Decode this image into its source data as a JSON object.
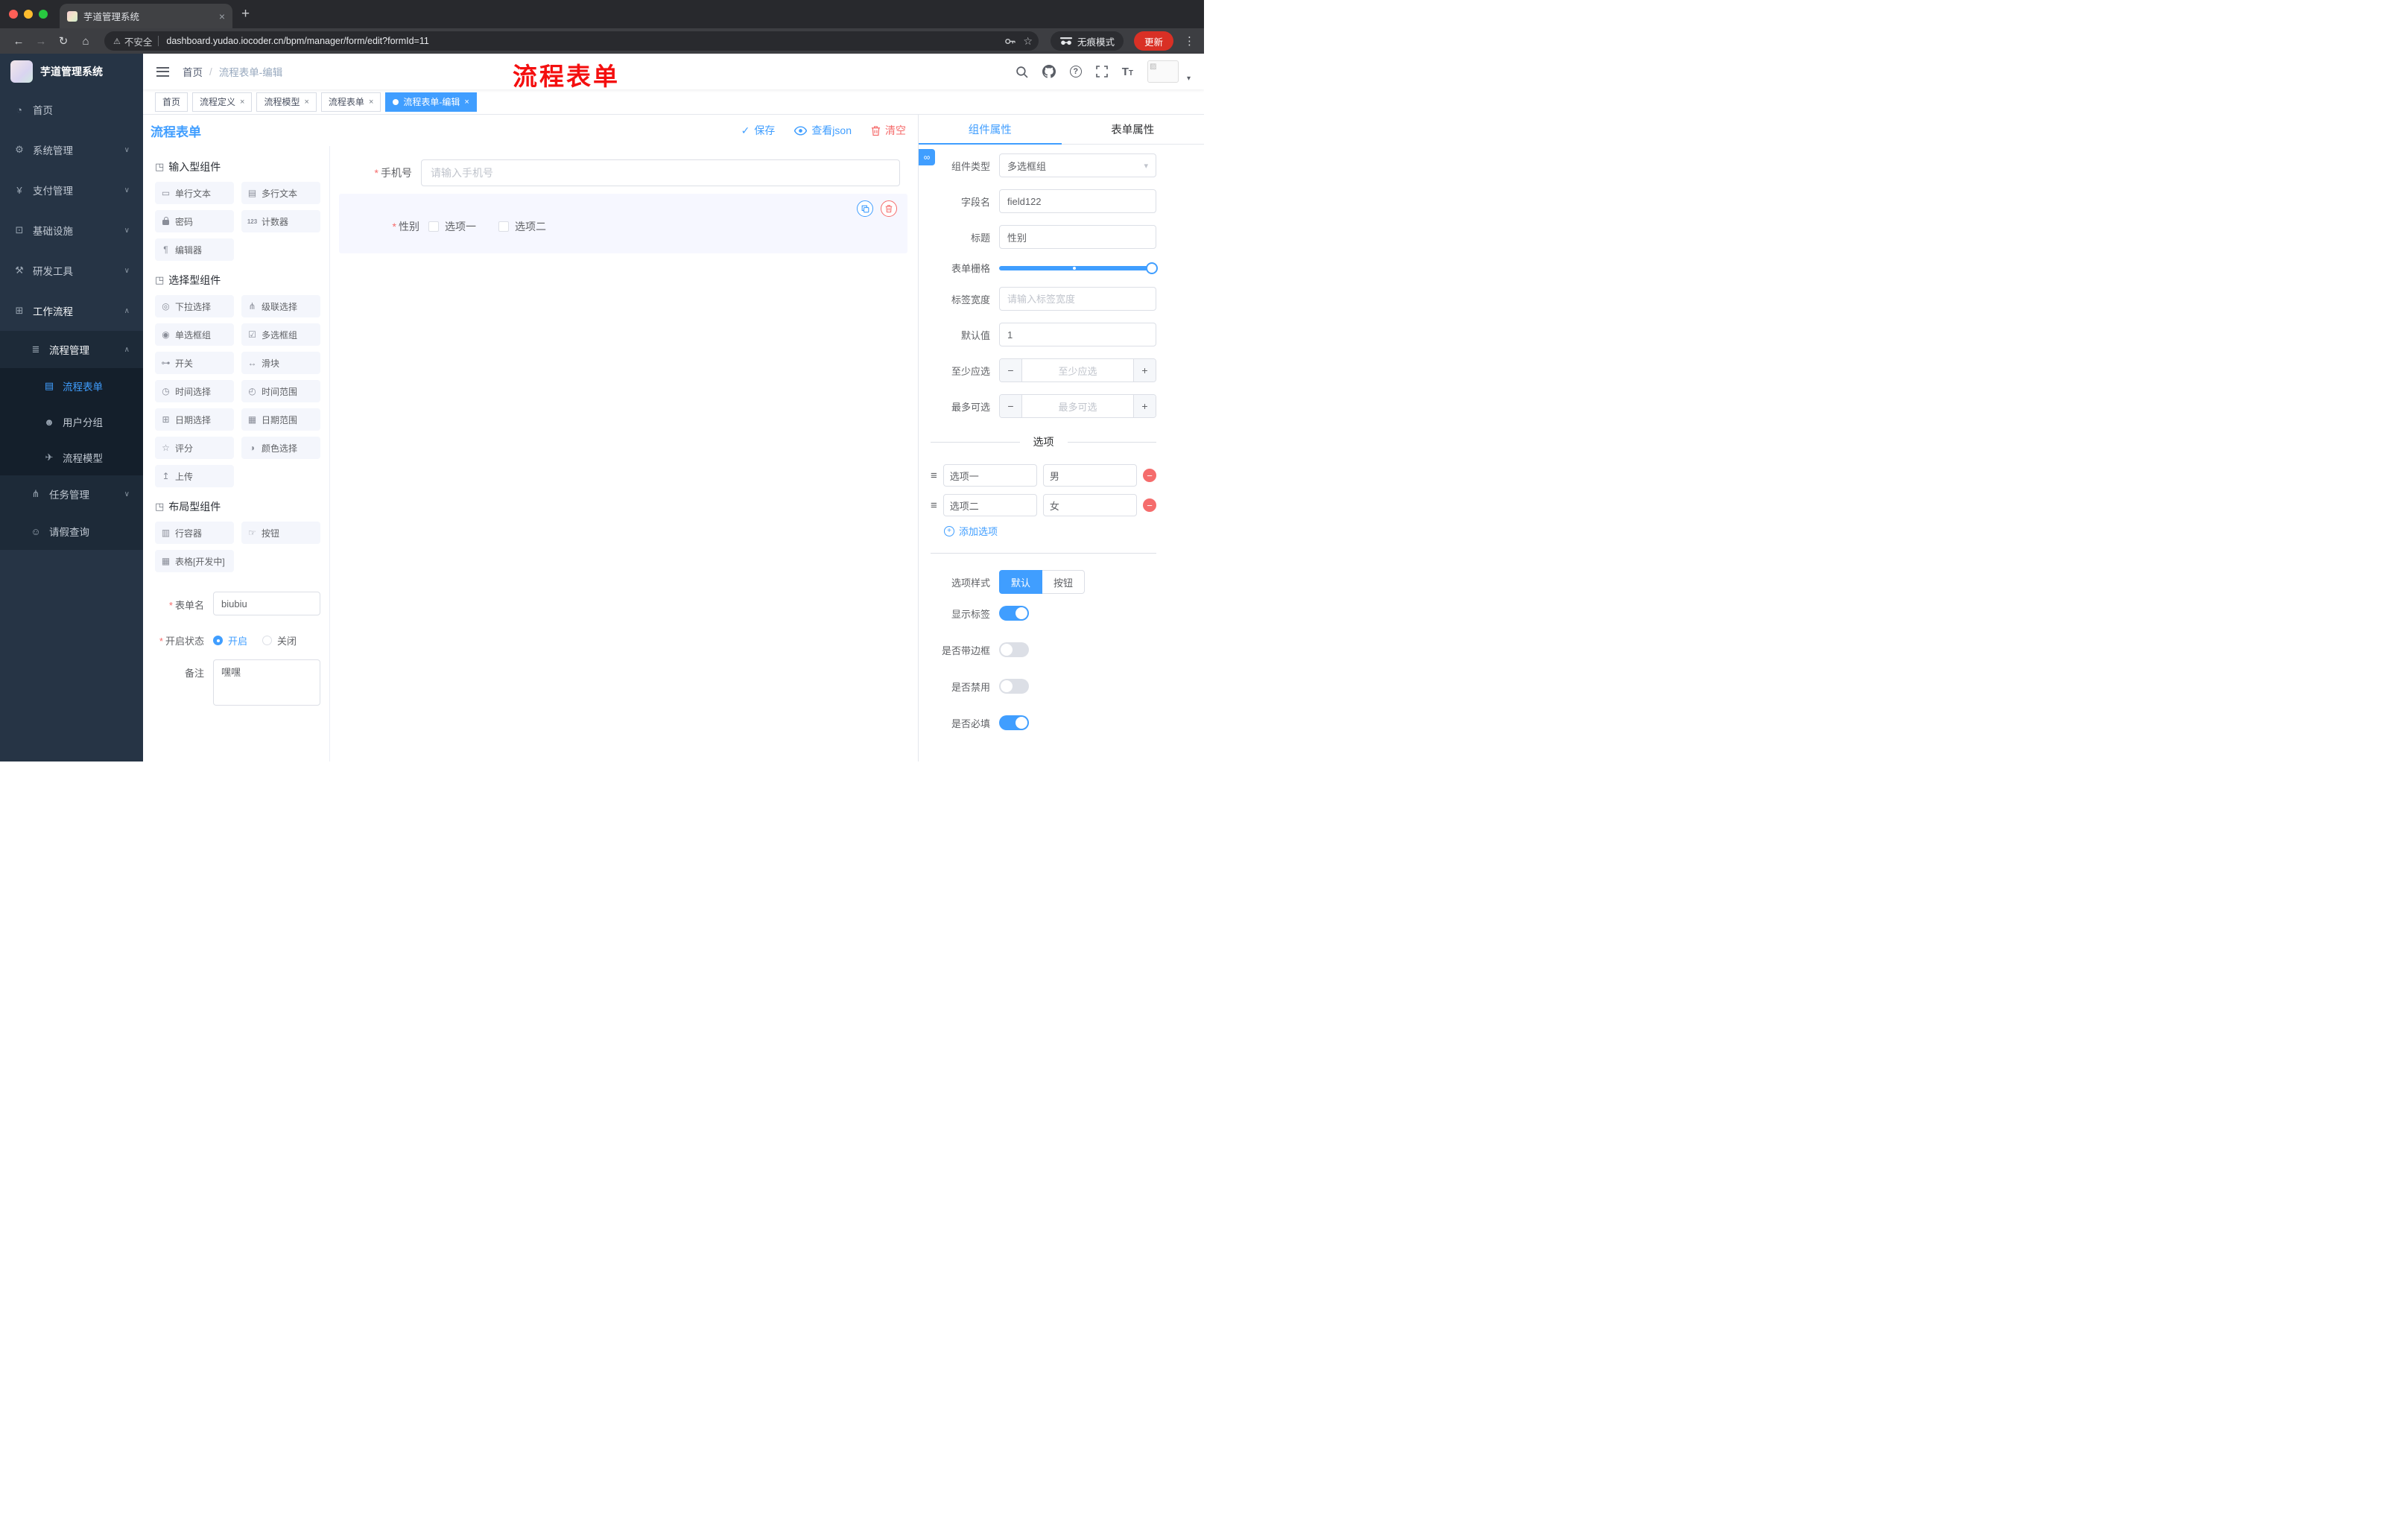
{
  "colors": {
    "primary": "#409eff",
    "danger": "#f56c6c"
  },
  "browser": {
    "tab_title": "芋道管理系统",
    "security_label": "不安全",
    "url": "dashboard.yudao.iocoder.cn/bpm/manager/form/edit?formId=11",
    "incognito_label": "无痕模式",
    "update_label": "更新"
  },
  "sidebar": {
    "logo_title": "芋道管理系统",
    "items": [
      {
        "label": "首页"
      },
      {
        "label": "系统管理"
      },
      {
        "label": "支付管理"
      },
      {
        "label": "基础设施"
      },
      {
        "label": "研发工具"
      },
      {
        "label": "工作流程"
      },
      {
        "label": "流程管理"
      },
      {
        "label": "流程表单"
      },
      {
        "label": "用户分组"
      },
      {
        "label": "流程模型"
      },
      {
        "label": "任务管理"
      },
      {
        "label": "请假查询"
      }
    ]
  },
  "header": {
    "breadcrumb_home": "首页",
    "breadcrumb_separator": "/",
    "breadcrumb_current": "流程表单-编辑",
    "annotation": "流程表单"
  },
  "tagbar": {
    "tags": [
      {
        "label": "首页",
        "closable": false,
        "active": false
      },
      {
        "label": "流程定义",
        "closable": true,
        "active": false
      },
      {
        "label": "流程模型",
        "closable": true,
        "active": false
      },
      {
        "label": "流程表单",
        "closable": true,
        "active": false
      },
      {
        "label": "流程表单-编辑",
        "closable": true,
        "active": true
      }
    ]
  },
  "designer": {
    "title": "流程表单",
    "actions": {
      "save": "保存",
      "view_json": "查看json",
      "clear": "清空"
    },
    "groups": [
      {
        "title": "输入型组件",
        "items": [
          "单行文本",
          "多行文本",
          "密码",
          "计数器",
          "编辑器"
        ]
      },
      {
        "title": "选择型组件",
        "items": [
          "下拉选择",
          "级联选择",
          "单选框组",
          "多选框组",
          "开关",
          "滑块",
          "时间选择",
          "时间范围",
          "日期选择",
          "日期范围",
          "评分",
          "颜色选择",
          "上传"
        ]
      },
      {
        "title": "布局型组件",
        "items": [
          "行容器",
          "按钮",
          "表格[开发中]"
        ]
      }
    ],
    "meta": {
      "name_label": "表单名",
      "name_value": "biubiu",
      "status_label": "开启状态",
      "status_on": "开启",
      "status_off": "关闭",
      "remark_label": "备注",
      "remark_value": "嘿嘿"
    },
    "canvas": {
      "phone_label": "手机号",
      "phone_placeholder": "请输入手机号",
      "gender_label": "性别",
      "gender_option1": "选项一",
      "gender_option2": "选项二"
    }
  },
  "props": {
    "tab_component": "组件属性",
    "tab_form": "表单属性",
    "type_label": "组件类型",
    "type_value": "多选框组",
    "field_label": "字段名",
    "field_value": "field122",
    "title_label": "标题",
    "title_value": "性别",
    "grid_label": "表单栅格",
    "width_label": "标签宽度",
    "width_placeholder": "请输入标签宽度",
    "default_label": "默认值",
    "default_value": "1",
    "min_label": "至少应选",
    "min_placeholder": "至少应选",
    "max_label": "最多可选",
    "max_placeholder": "最多可选",
    "options_divider": "选项",
    "options": [
      {
        "label": "选项一",
        "value": "男"
      },
      {
        "label": "选项二",
        "value": "女"
      }
    ],
    "add_option": "添加选项",
    "style_label": "选项样式",
    "style_default": "默认",
    "style_button": "按钮",
    "switches": [
      {
        "label": "显示标签",
        "on": true
      },
      {
        "label": "是否带边框",
        "on": false
      },
      {
        "label": "是否禁用",
        "on": false
      },
      {
        "label": "是否必填",
        "on": true
      }
    ]
  }
}
